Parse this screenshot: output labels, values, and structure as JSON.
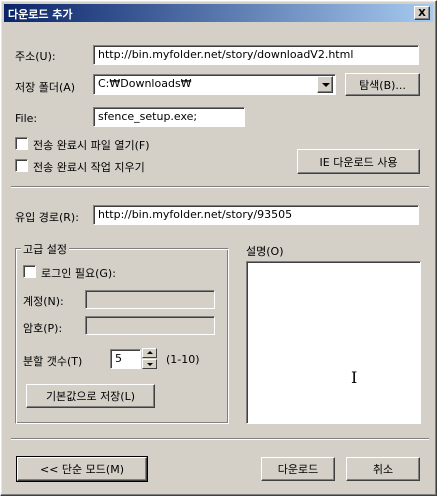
{
  "window": {
    "title": "다운로드 추가",
    "close_glyph": "X",
    "title_gradient": [
      "#0a246a",
      "#a6caf0"
    ]
  },
  "form": {
    "address_label": "주소(U):",
    "address_value": "http://bin.myfolder.net/story/downloadV2.html",
    "save_folder_label": "저장 폴더(A)",
    "save_folder_value": "C:₩Downloads₩",
    "browse_button": "탐색(B)...",
    "file_label": "File:",
    "file_value": "sfence_setup.exe;",
    "open_after_complete": {
      "label": "전송 완료시 파일 열기(F)",
      "checked": false
    },
    "clear_after_complete": {
      "label": "전송 완료시 작업 지우기",
      "checked": false
    },
    "ie_download_button": "IE 다운로드 사용",
    "referrer_label": "유입 경로(R):",
    "referrer_value": "http://bin.myfolder.net/story/93505"
  },
  "advanced": {
    "group_title": "고급 설정",
    "login_required": {
      "label": "로그인 필요(G):",
      "checked": false
    },
    "account_label": "계정(N):",
    "account_value": "",
    "password_label": "암호(P):",
    "password_value": "",
    "split_count_label": "분할 갯수(T)",
    "split_count_value": "5",
    "split_range": "(1-10)",
    "save_default_button": "기본값으로 저장(L)"
  },
  "description": {
    "label": "설명(O)",
    "value": ""
  },
  "footer": {
    "simple_mode_button": "<< 단순 모드(M)",
    "download_button": "다운로드",
    "cancel_button": "취소"
  }
}
